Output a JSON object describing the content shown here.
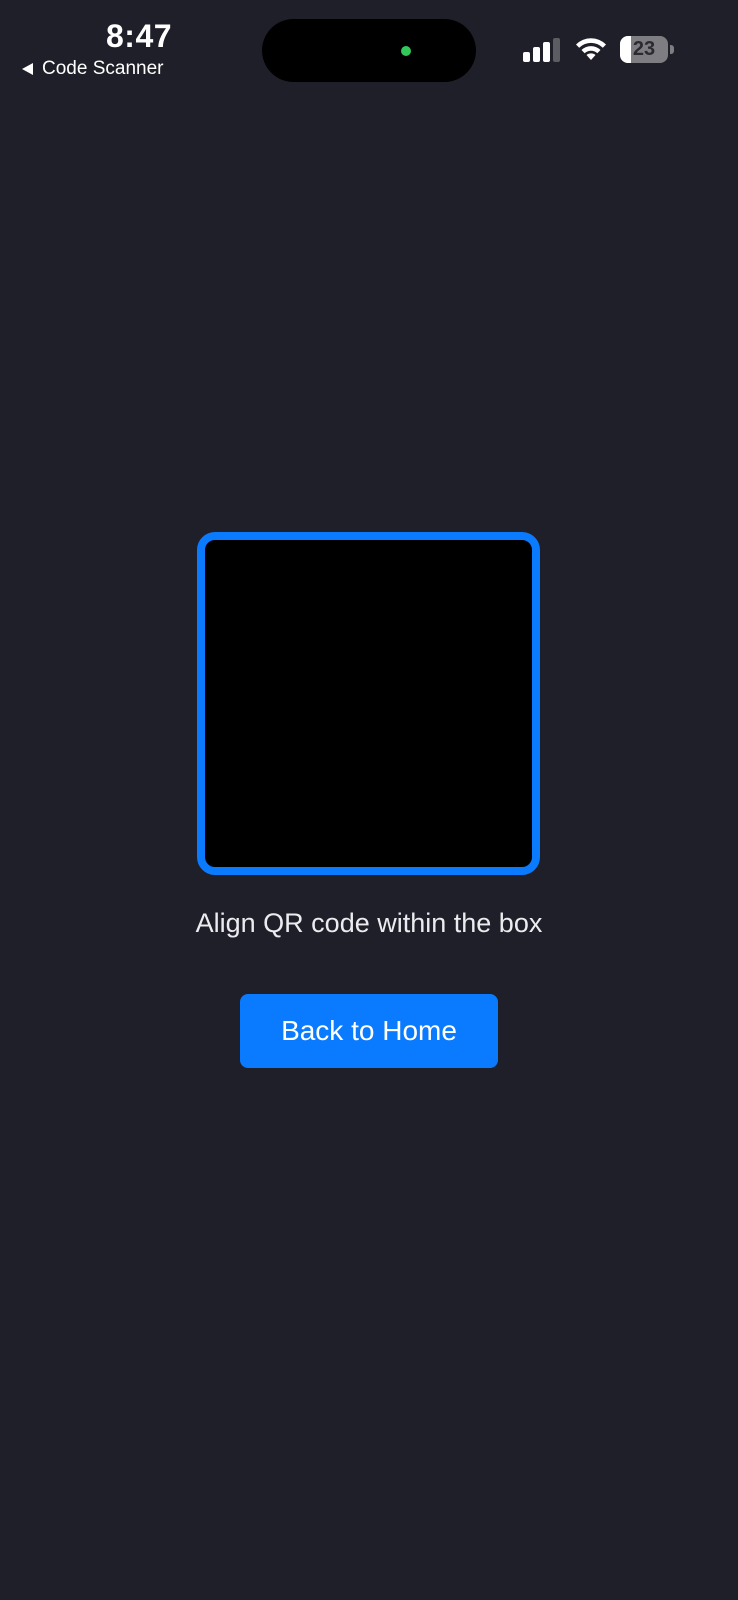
{
  "status_bar": {
    "time": "8:47",
    "back_app_label": "Code Scanner",
    "battery_level": "23",
    "battery_fraction": 0.23,
    "icons": [
      "cellular-signal-icon",
      "wifi-icon",
      "battery-icon",
      "camera-indicator-icon"
    ],
    "camera_indicator_color": "#32c759"
  },
  "scanner": {
    "hint": "Align QR code within the box",
    "frame_color": "#0a7bff"
  },
  "actions": {
    "home_button_label": "Back to Home"
  },
  "colors": {
    "background": "#1f1f29",
    "accent": "#0a7bff"
  }
}
